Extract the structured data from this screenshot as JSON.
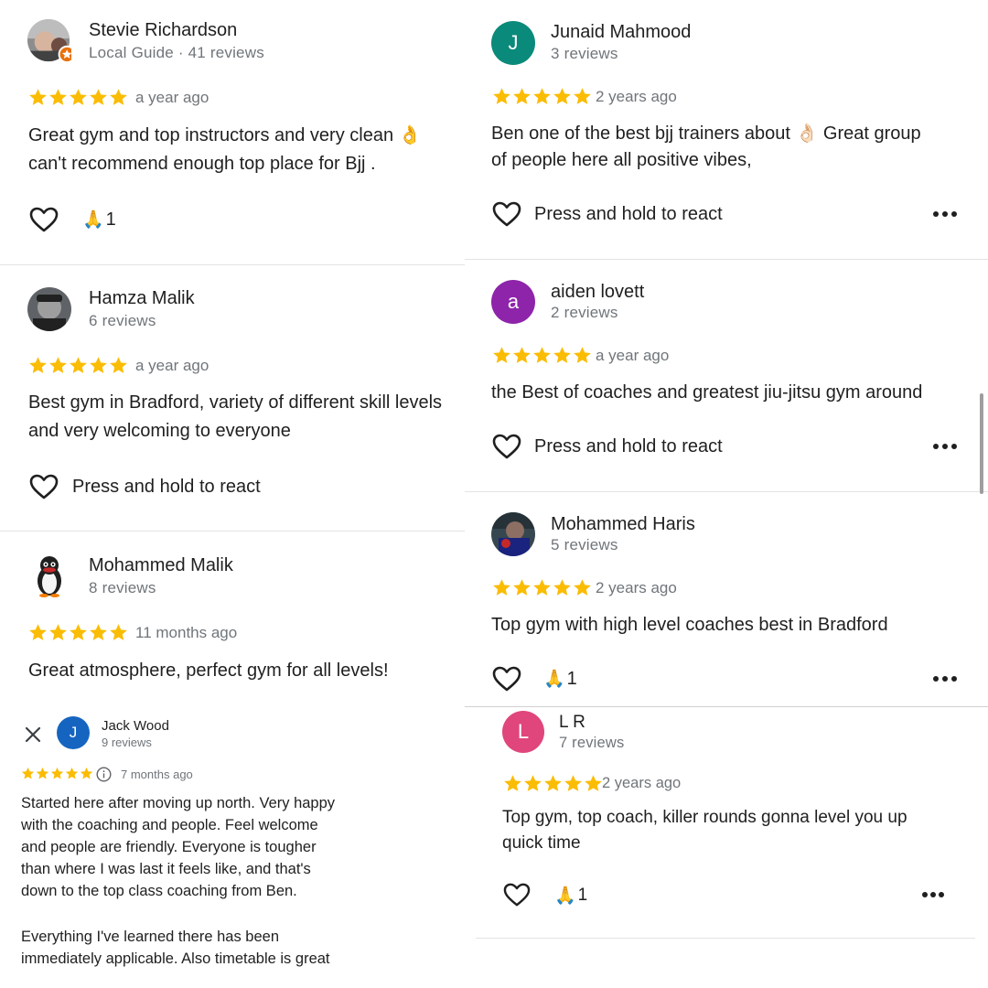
{
  "colors": {
    "star": "#fbbc04",
    "heart": "#1f1f1f",
    "avatar_junaid": "#0a8a7a",
    "avatar_aiden": "#8e24aa",
    "avatar_jack": "#1565c0",
    "avatar_lr": "#e0457b",
    "local_guide_badge": "#e8710a"
  },
  "reviews_left": [
    {
      "name": "Stevie Richardson",
      "meta": "Local Guide · 41 reviews",
      "rating": 5,
      "ago": "a year ago",
      "text_lines": [
        "Great gym and top instructors and very clean 👌",
        "can't recommend enough top place for Bjj ."
      ],
      "reaction_count": "1",
      "reaction_emoji": "🙏"
    },
    {
      "name": "Hamza Malik",
      "meta": "6 reviews",
      "rating": 5,
      "ago": "a year ago",
      "text_lines": [
        "Best gym in Bradford, variety of different skill levels",
        "and very welcoming to everyone"
      ],
      "react_label": "Press and hold to react"
    },
    {
      "name": "Mohammed Malik",
      "meta": "8 reviews",
      "rating": 5,
      "ago": "11 months ago",
      "text_lines": [
        "Great atmosphere, perfect gym for all levels!"
      ]
    }
  ],
  "jack_review": {
    "close_icon": "close-icon",
    "avatar_letter": "J",
    "name": "Jack Wood",
    "meta": "9 reviews",
    "rating": 5,
    "info_icon": "info-icon",
    "ago": "7 months ago",
    "text_lines": [
      "Started here after moving up north. Very happy",
      "with the coaching and people. Feel welcome",
      "and people are friendly. Everyone is tougher",
      "than where I was last it feels like, and that's",
      "down to the top class coaching from Ben.",
      "",
      "Everything I've learned there has been",
      "immediately applicable. Also timetable is great"
    ]
  },
  "reviews_right": [
    {
      "avatar_letter": "J",
      "name": "Junaid Mahmood",
      "meta": "3 reviews",
      "rating": 5,
      "ago": "2 years ago",
      "text_lines": [
        "Ben one of the best bjj trainers about 👌🏻  Great group",
        "of people here all positive vibes,"
      ],
      "react_label": "Press and hold to react"
    },
    {
      "avatar_letter": "a",
      "name": "aiden lovett",
      "meta": "2 reviews",
      "rating": 5,
      "ago": "a year ago",
      "text_lines": [
        "the Best of coaches and greatest jiu-jitsu  gym around"
      ],
      "react_label": "Press and hold to react"
    },
    {
      "name": "Mohammed Haris",
      "meta": "5 reviews",
      "rating": 5,
      "ago": "2 years ago",
      "text_lines": [
        "Top gym with high level coaches best in Bradford"
      ],
      "reaction_count": "1",
      "reaction_emoji": "🙏"
    },
    {
      "avatar_letter": "L",
      "name": "L R",
      "meta": "7 reviews",
      "rating": 5,
      "ago": "2 years ago",
      "text_lines": [
        "Top gym, top coach, killer rounds gonna level you up",
        "quick time"
      ],
      "reaction_count": "1",
      "reaction_emoji": "🙏"
    }
  ]
}
